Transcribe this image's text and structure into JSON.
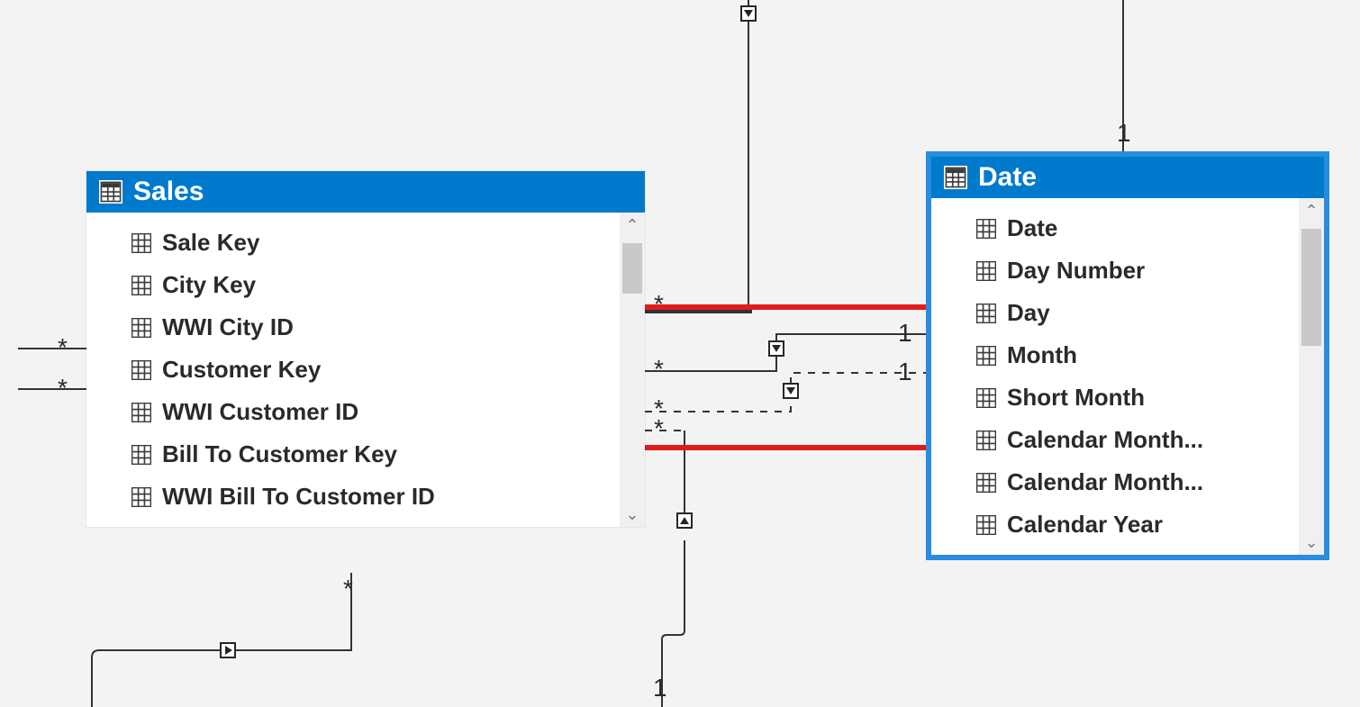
{
  "tables": {
    "sales": {
      "title": "Sales",
      "fields": [
        "Sale Key",
        "City Key",
        "WWI City ID",
        "Customer Key",
        "WWI Customer ID",
        "Bill To Customer Key",
        "WWI Bill To Customer ID"
      ]
    },
    "date": {
      "title": "Date",
      "fields": [
        "Date",
        "Day Number",
        "Day",
        "Month",
        "Short Month",
        "Calendar Month...",
        "Calendar Month...",
        "Calendar Year"
      ]
    }
  },
  "cardinality": {
    "star": "*",
    "one": "1"
  }
}
